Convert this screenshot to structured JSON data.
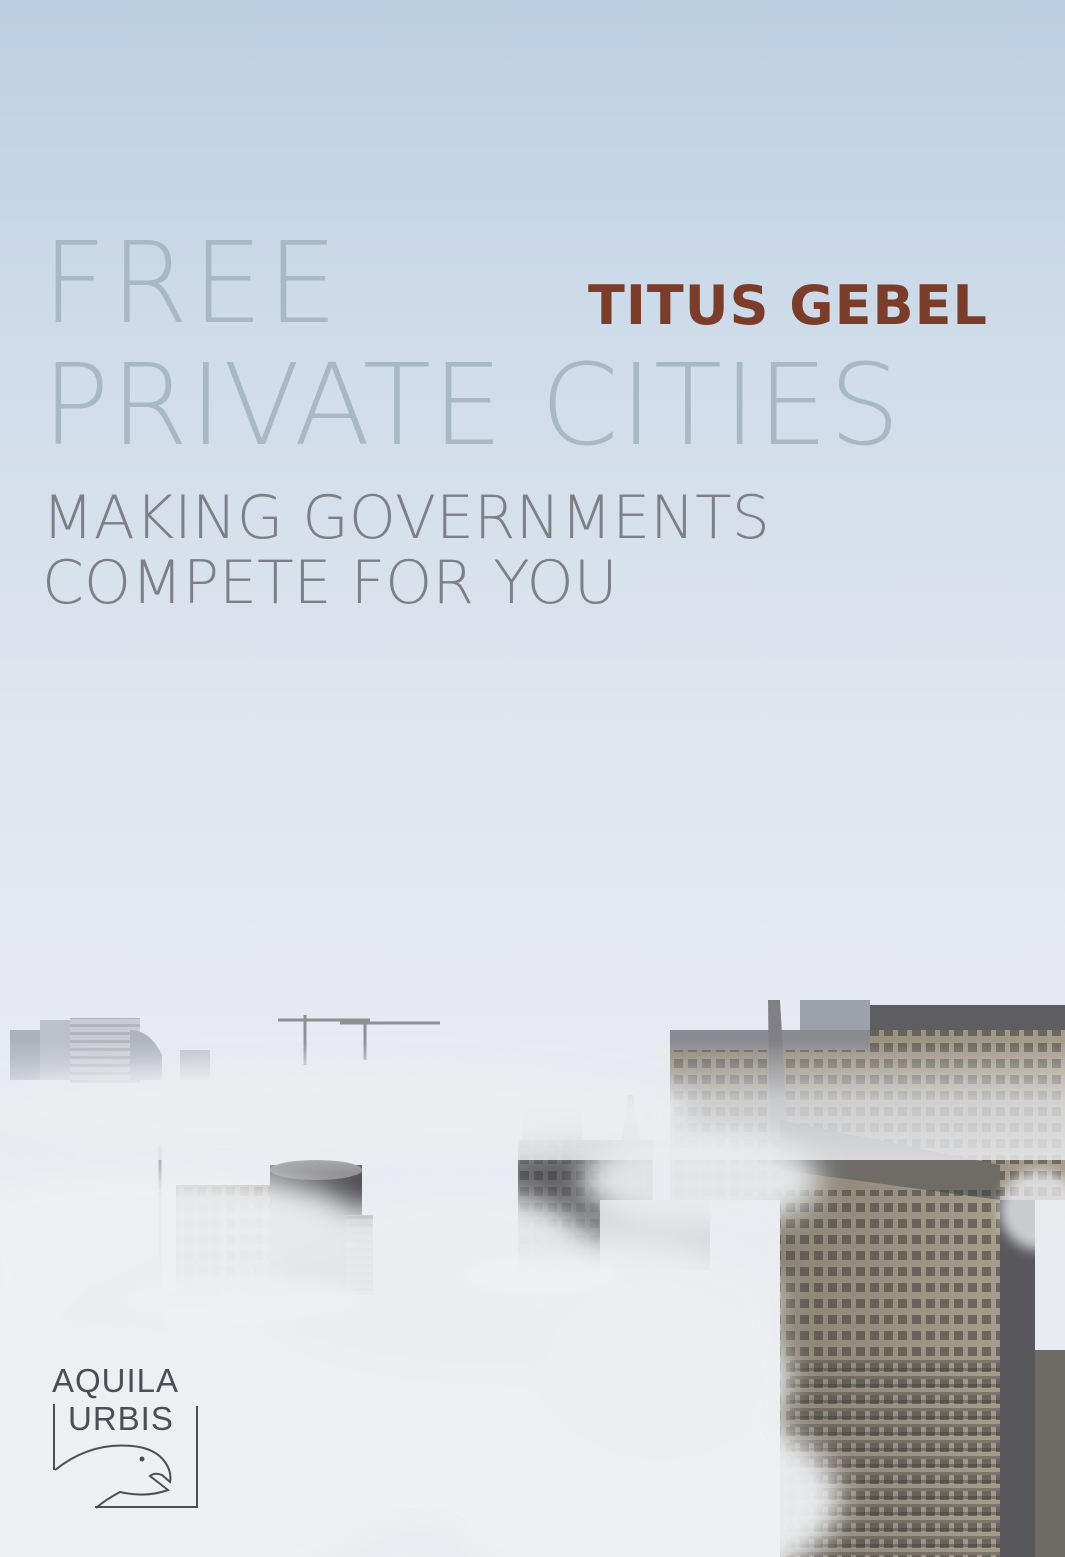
{
  "cover": {
    "title_line1": "FREE",
    "title_line2": "PRIVATE CITIES",
    "author": "TITUS GEBEL",
    "subtitle_line1": "MAKING GOVERNMENTS",
    "subtitle_line2": "COMPETE FOR YOU"
  },
  "publisher": {
    "line1": "AQUILA",
    "line2": "URBIS",
    "emblem_icon": "eagle-head-icon"
  },
  "colors": {
    "title": "#a9b9c4",
    "author": "#7b3c2a",
    "subtitle": "#7c8084",
    "sky_top": "#bccfe2",
    "fog": "#e9ecf0"
  }
}
